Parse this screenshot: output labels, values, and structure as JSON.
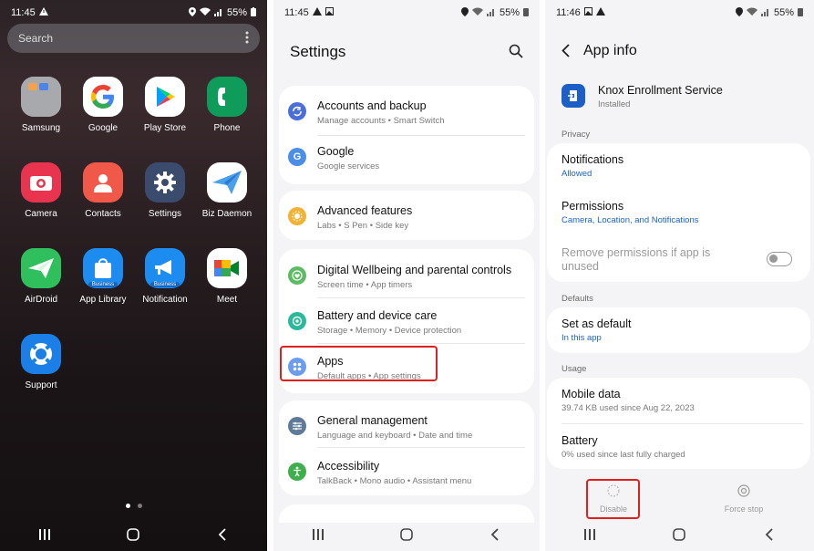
{
  "home": {
    "status": {
      "time": "11:45",
      "battery": "55%"
    },
    "search_placeholder": "Search",
    "apps": [
      {
        "label": "Samsung"
      },
      {
        "label": "Google"
      },
      {
        "label": "Play Store"
      },
      {
        "label": "Phone"
      },
      {
        "label": "Camera"
      },
      {
        "label": "Contacts"
      },
      {
        "label": "Settings"
      },
      {
        "label": "Biz Daemon"
      },
      {
        "label": "AirDroid"
      },
      {
        "label": "App Library"
      },
      {
        "label": "Notification"
      },
      {
        "label": "Meet"
      },
      {
        "label": "Support"
      }
    ],
    "badge": "Business"
  },
  "settings": {
    "status": {
      "time": "11:45",
      "battery": "55%"
    },
    "title": "Settings",
    "items": [
      {
        "title": "Accounts and backup",
        "sub": "Manage accounts  •  Smart Switch",
        "color": "#4a6fd8"
      },
      {
        "title": "Google",
        "sub": "Google services",
        "color": "#4a8ee8"
      },
      {
        "title": "Advanced features",
        "sub": "Labs  •  S Pen  •  Side key",
        "color": "#f2b233"
      },
      {
        "title": "Digital Wellbeing and parental controls",
        "sub": "Screen time  •  App timers",
        "color": "#5dbb63"
      },
      {
        "title": "Battery and device care",
        "sub": "Storage  •  Memory  •  Device protection",
        "color": "#2bb89b"
      },
      {
        "title": "Apps",
        "sub": "Default apps  •  App settings",
        "color": "#6b9cf0"
      },
      {
        "title": "General management",
        "sub": "Language and keyboard  •  Date and time",
        "color": "#5d7a99"
      },
      {
        "title": "Accessibility",
        "sub": "TalkBack  •  Mono audio  •  Assistant menu",
        "color": "#3fae4c"
      }
    ]
  },
  "appinfo": {
    "status": {
      "time": "11:46",
      "battery": "55%"
    },
    "title": "App info",
    "app_name": "Knox Enrollment Service",
    "app_state": "Installed",
    "privacy_header": "Privacy",
    "notifications": {
      "title": "Notifications",
      "value": "Allowed"
    },
    "permissions": {
      "title": "Permissions",
      "value": "Camera, Location, and Notifications"
    },
    "remove_perms_line1": "Remove permissions if app is",
    "remove_perms_line2": "unused",
    "defaults_header": "Defaults",
    "set_default": {
      "title": "Set as default",
      "value": "In this app"
    },
    "usage_header": "Usage",
    "mobile_data": {
      "title": "Mobile data",
      "value": "39.74 KB used since Aug 22, 2023"
    },
    "battery": {
      "title": "Battery",
      "value": "0% used since last fully charged"
    },
    "disable_label": "Disable",
    "force_stop_label": "Force stop"
  }
}
